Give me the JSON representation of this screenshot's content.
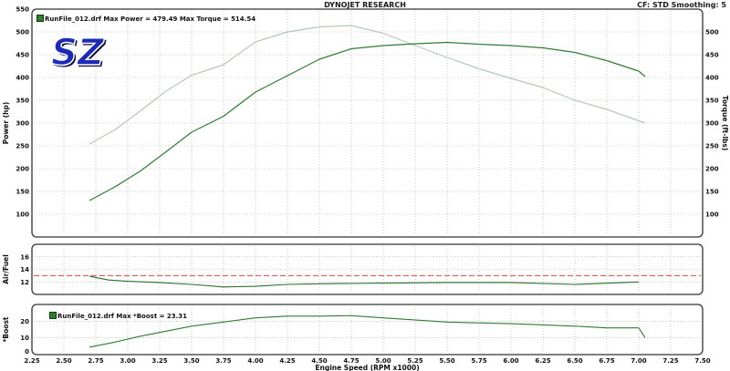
{
  "header": {
    "title": "DYNOJET RESEARCH",
    "settings": "CF: STD  Smoothing: 5"
  },
  "logo": {
    "text": "SZ",
    "colors": {
      "fill": "#1b2bb8",
      "outline": "#ffffff",
      "shadow": "#0a0a40"
    }
  },
  "legend": {
    "power_torque": "RunFile_012.drf Max Power = 479.49   Max Torque = 514.54",
    "boost": "RunFile_012.drf Max *Boost = 23.31"
  },
  "colors": {
    "power_line": "#2e7d32",
    "torque_line": "#b6c8b6",
    "airfuel_line": "#2e6b2e",
    "boost_line": "#2e7d32",
    "reference_line": "#d94040",
    "grid": "#9aa4aa",
    "panel_border": "#333333"
  },
  "chart_data": [
    {
      "type": "line",
      "panel": "power_torque",
      "xlabel": "",
      "ylabel": "Power (hp)",
      "y2label": "Torque (ft-lbs)",
      "xlim": [
        2.25,
        7.5
      ],
      "ylim": [
        50,
        550
      ],
      "y2lim": [
        50,
        550
      ],
      "yticks": [
        100,
        150,
        200,
        250,
        300,
        350,
        400,
        450,
        500,
        550
      ],
      "y2ticks": [
        100,
        150,
        200,
        250,
        300,
        350,
        400,
        450,
        500
      ],
      "grid": true,
      "series": [
        {
          "name": "Power",
          "x": [
            2.7,
            2.9,
            3.1,
            3.3,
            3.5,
            3.75,
            4.0,
            4.25,
            4.5,
            4.75,
            5.0,
            5.25,
            5.5,
            5.75,
            6.0,
            6.25,
            6.5,
            6.75,
            7.0,
            7.05
          ],
          "values": [
            130,
            160,
            195,
            237,
            280,
            315,
            368,
            404,
            440,
            463,
            470,
            474,
            477,
            473,
            470,
            465,
            455,
            437,
            414,
            402
          ]
        },
        {
          "name": "Torque",
          "x": [
            2.7,
            2.9,
            3.1,
            3.3,
            3.5,
            3.75,
            4.0,
            4.25,
            4.5,
            4.75,
            5.0,
            5.25,
            5.5,
            5.75,
            6.0,
            6.25,
            6.5,
            6.75,
            7.0,
            7.05
          ],
          "values": [
            254,
            285,
            327,
            370,
            405,
            428,
            478,
            500,
            511,
            514,
            497,
            470,
            444,
            419,
            398,
            378,
            350,
            330,
            305,
            300
          ]
        }
      ]
    },
    {
      "type": "line",
      "panel": "air_fuel",
      "ylabel": "Air/Fuel",
      "xlim": [
        2.25,
        7.5
      ],
      "ylim": [
        10,
        18
      ],
      "yticks": [
        10,
        12,
        14,
        16,
        18
      ],
      "grid": true,
      "reference_line": 13,
      "series": [
        {
          "name": "Air/Fuel",
          "x": [
            2.7,
            2.85,
            3.0,
            3.25,
            3.5,
            3.75,
            4.0,
            4.25,
            4.5,
            5.0,
            5.5,
            6.0,
            6.5,
            7.0
          ],
          "values": [
            12.9,
            12.3,
            12.1,
            11.9,
            11.6,
            11.2,
            11.3,
            11.6,
            11.7,
            11.8,
            11.9,
            11.9,
            11.6,
            12.0
          ]
        }
      ]
    },
    {
      "type": "line",
      "panel": "boost",
      "xlabel": "Engine Speed (RPM x1000)",
      "ylabel": "*Boost",
      "xlim": [
        2.25,
        7.5
      ],
      "ylim": [
        0,
        30
      ],
      "yticks": [
        0,
        10,
        20
      ],
      "xticks": [
        "2.25",
        "2.50",
        "2.75",
        "3.00",
        "3.25",
        "3.50",
        "3.75",
        "4.00",
        "4.25",
        "4.50",
        "4.75",
        "5.00",
        "5.25",
        "5.50",
        "5.75",
        "6.00",
        "6.25",
        "6.50",
        "6.75",
        "7.00",
        "7.25",
        "7.50"
      ],
      "grid": true,
      "series": [
        {
          "name": "*Boost",
          "x": [
            2.7,
            2.9,
            3.1,
            3.3,
            3.5,
            3.75,
            4.0,
            4.25,
            4.5,
            4.75,
            5.0,
            5.5,
            6.0,
            6.5,
            6.75,
            7.0,
            7.05
          ],
          "values": [
            4.5,
            7.5,
            11,
            14,
            17,
            19.5,
            22,
            23,
            23,
            23.3,
            22,
            19.5,
            18.5,
            17,
            16,
            16,
            10
          ]
        }
      ]
    }
  ]
}
